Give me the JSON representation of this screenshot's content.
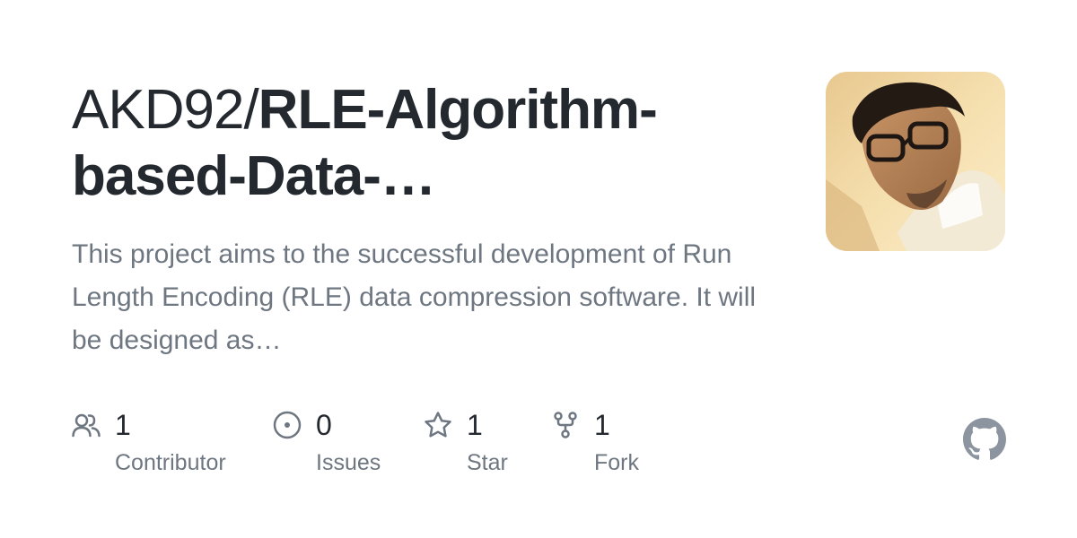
{
  "repo": {
    "owner": "AKD92/",
    "name_line1": "RLE-Algorithm-",
    "name_line2": "based-Data-…",
    "description": "This project aims to the successful development of Run Length Encoding (RLE) data compression software. It will be designed as…"
  },
  "stats": {
    "contributors": {
      "value": "1",
      "label": "Contributor",
      "icon": "people-icon"
    },
    "issues": {
      "value": "0",
      "label": "Issues",
      "icon": "issue-opened-icon"
    },
    "stars": {
      "value": "1",
      "label": "Star",
      "icon": "star-icon"
    },
    "forks": {
      "value": "1",
      "label": "Fork",
      "icon": "repo-forked-icon"
    }
  },
  "colors": {
    "title": "#24292f",
    "muted": "#6e7781",
    "github_mark": "#8c959f"
  }
}
